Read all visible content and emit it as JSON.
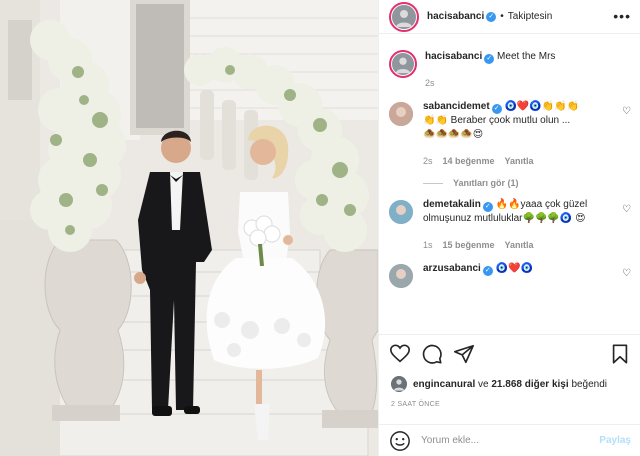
{
  "post": {
    "username": "hacisabanci",
    "follow_status": "Takiptesin",
    "more_label": "•••",
    "caption": "Meet the Mrs",
    "caption_time": "2s",
    "photo_icon": "wedding-photo"
  },
  "comments": [
    {
      "username": "sabancidemet",
      "emojis_line1": "🧿❤️🧿👏👏👏",
      "text": "👏👏 Beraber çook mutlu olun ...",
      "emojis_line2": "🧆🧆🧆🧆😍",
      "time": "2s",
      "likes": "14 beğenme",
      "reply": "Yanıtla",
      "view_replies": "Yanıtları gör (1)"
    },
    {
      "username": "demetakalin",
      "text": "🔥🔥yaaa çok güzel olmuşunuz mutluluklar🌳🌳🌳🧿 😍",
      "time": "1s",
      "likes": "15 beğenme",
      "reply": "Yanıtla"
    },
    {
      "username": "arzusabanci",
      "text": "🧿❤️🧿"
    }
  ],
  "likes": {
    "liker": "engincanural",
    "connector": "ve",
    "count": "21.868 diğer kişi",
    "suffix": "beğendi"
  },
  "date": "2 SAAT ÖNCE",
  "composer": {
    "placeholder": "Yorum ekle...",
    "post_label": "Paylaş"
  },
  "colors": {
    "verified": "#3897f0",
    "story_ring": "#e1306c",
    "muted": "#8e8e8e"
  }
}
